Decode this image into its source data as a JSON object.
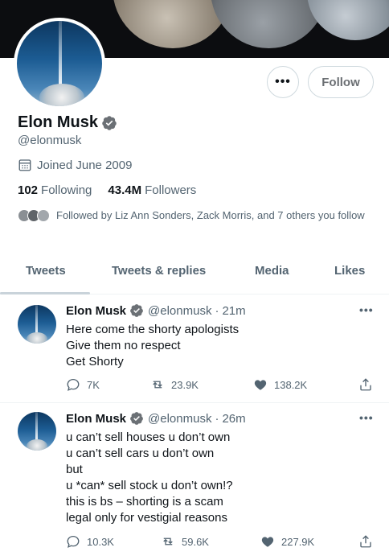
{
  "profile": {
    "name": "Elon Musk",
    "handle": "@elonmusk",
    "joined": "Joined June 2009",
    "following_count": "102",
    "following_label": "Following",
    "followers_count": "43.4M",
    "followers_label": "Followers",
    "followed_by": "Followed by Liz Ann Sonders, Zack Morris, and 7 others you follow",
    "more_label": "•••",
    "follow_label": "Follow"
  },
  "tabs": [
    {
      "label": "Tweets"
    },
    {
      "label": "Tweets & replies"
    },
    {
      "label": "Media"
    },
    {
      "label": "Likes"
    }
  ],
  "tweets": [
    {
      "name": "Elon Musk",
      "handle": "@elonmusk",
      "dot": "·",
      "time": "21m",
      "more": "•••",
      "lines": [
        "Here come the shorty apologists",
        "Give them no respect",
        "Get Shorty"
      ],
      "replies": "7K",
      "retweets": "23.9K",
      "likes": "138.2K"
    },
    {
      "name": "Elon Musk",
      "handle": "@elonmusk",
      "dot": "·",
      "time": "26m",
      "more": "•••",
      "lines": [
        "u can’t sell houses u don’t own",
        "u can’t sell cars u don’t own",
        "but",
        "u *can* sell stock u don’t own!?",
        "this is bs – shorting is a scam",
        "legal only for vestigial reasons"
      ],
      "replies": "10.3K",
      "retweets": "59.6K",
      "likes": "227.9K"
    }
  ],
  "icons": {
    "verified": "verified-badge-icon",
    "calendar": "calendar-icon",
    "reply": "reply-icon",
    "retweet": "retweet-icon",
    "like": "heart-icon",
    "share": "share-icon"
  },
  "colors": {
    "verified": "#1d9bf0",
    "secondary_text": "#536471",
    "primary_text": "#0f1419"
  }
}
